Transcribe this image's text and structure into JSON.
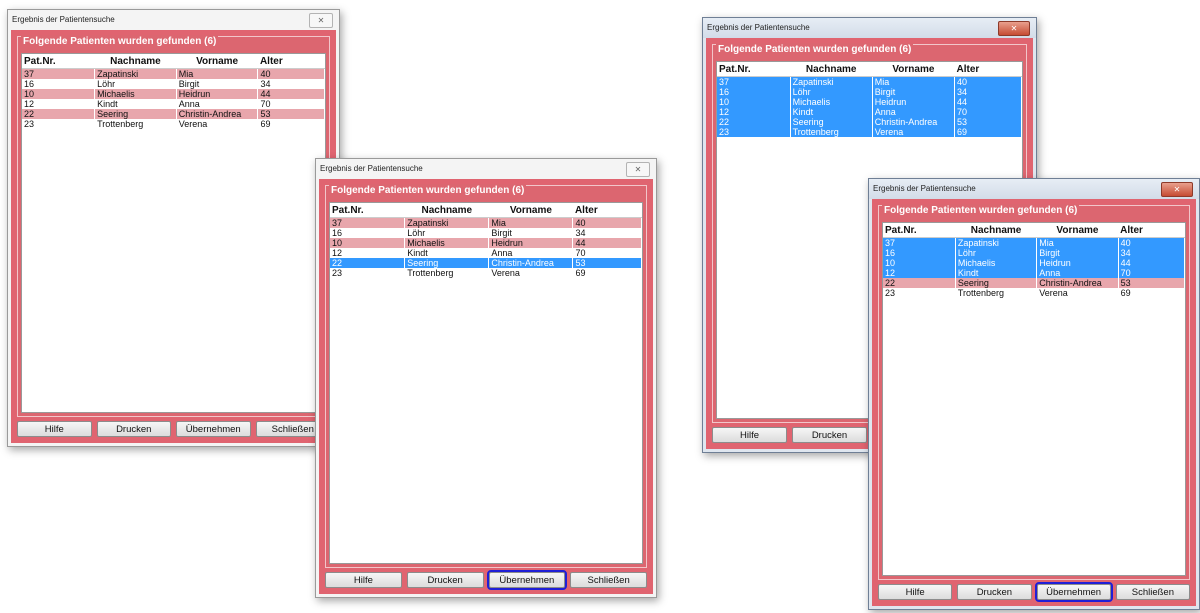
{
  "window_title": "Ergebnis der Patientensuche",
  "group_label": "Folgende Patienten wurden gefunden (6)",
  "columns": [
    "Pat.Nr.",
    "Nachname",
    "Vorname",
    "Alter"
  ],
  "patients": [
    {
      "nr": "37",
      "nachname": "Zapatinski",
      "vorname": "Mia",
      "alter": "40"
    },
    {
      "nr": "16",
      "nachname": "Löhr",
      "vorname": "Birgit",
      "alter": "34"
    },
    {
      "nr": "10",
      "nachname": "Michaelis",
      "vorname": "Heidrun",
      "alter": "44"
    },
    {
      "nr": "12",
      "nachname": "Kindt",
      "vorname": "Anna",
      "alter": "70"
    },
    {
      "nr": "22",
      "nachname": "Seering",
      "vorname": "Christin-Andrea",
      "alter": "53"
    },
    {
      "nr": "23",
      "nachname": "Trottenberg",
      "vorname": "Verena",
      "alter": "69"
    }
  ],
  "buttons": {
    "hilfe": "Hilfe",
    "drucken": "Drucken",
    "uebernehmen": "Übernehmen",
    "schliessen": "Schließen"
  },
  "close_glyph": "✕",
  "windows": [
    {
      "row_states": [
        "pink",
        "white",
        "pink",
        "white",
        "pink",
        "white"
      ],
      "focus_button": ""
    },
    {
      "row_states": [
        "pink",
        "white",
        "pink",
        "white",
        "sel",
        "white"
      ],
      "focus_button": "uebernehmen"
    },
    {
      "row_states": [
        "sel",
        "sel",
        "sel",
        "sel",
        "sel",
        "sel"
      ],
      "focus_button": ""
    },
    {
      "row_states": [
        "sel",
        "sel",
        "sel",
        "sel",
        "pink",
        "white"
      ],
      "focus_button": "uebernehmen"
    }
  ]
}
